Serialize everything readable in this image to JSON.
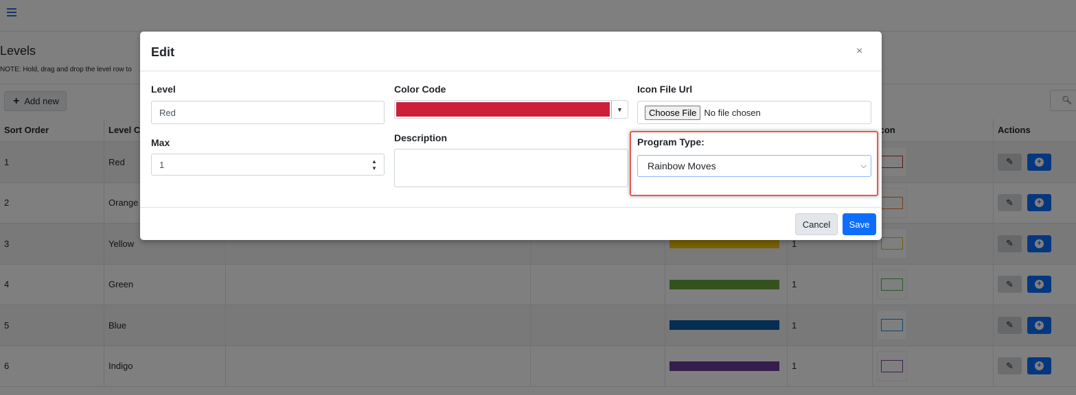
{
  "page": {
    "title": "Levels",
    "note": "NOTE: Hold, drag and drop the level row to",
    "add_new_label": "Add new",
    "search_icon": "search-icon"
  },
  "table": {
    "headers": [
      "Sort Order",
      "Level C",
      "",
      "",
      "",
      "",
      "Icon",
      "Actions"
    ],
    "rows": [
      {
        "sort": "1",
        "level": "Red",
        "max": "",
        "color": "",
        "icon_color": "#c62828"
      },
      {
        "sort": "2",
        "level": "Orange",
        "max": "",
        "color": "",
        "icon_color": "#e87722"
      },
      {
        "sort": "3",
        "level": "Yellow",
        "max": "1",
        "color": "#f2c200",
        "icon_color": "#e6b800"
      },
      {
        "sort": "4",
        "level": "Green",
        "max": "1",
        "color": "#6aa33a",
        "icon_color": "#4caf50"
      },
      {
        "sort": "5",
        "level": "Blue",
        "max": "1",
        "color": "#0d5aa7",
        "icon_color": "#1e88e5"
      },
      {
        "sort": "6",
        "level": "Indigo",
        "max": "1",
        "color": "#6a3d9a",
        "icon_color": "#7b3fa0"
      }
    ]
  },
  "modal": {
    "title": "Edit",
    "close_glyph": "×",
    "level_label": "Level",
    "level_value": "Red",
    "max_label": "Max",
    "max_value": "1",
    "color_label": "Color Code",
    "color_value": "#cd1f3c",
    "description_label": "Description",
    "description_value": "",
    "icon_label": "Icon File Url",
    "choose_file_label": "Choose File",
    "file_status": "No file chosen",
    "program_type_label": "Program Type:",
    "program_type_value": "Rainbow Moves",
    "cancel_label": "Cancel",
    "save_label": "Save"
  },
  "colors": {
    "accent": "#0d6efd",
    "highlight_border": "#e8594a"
  }
}
